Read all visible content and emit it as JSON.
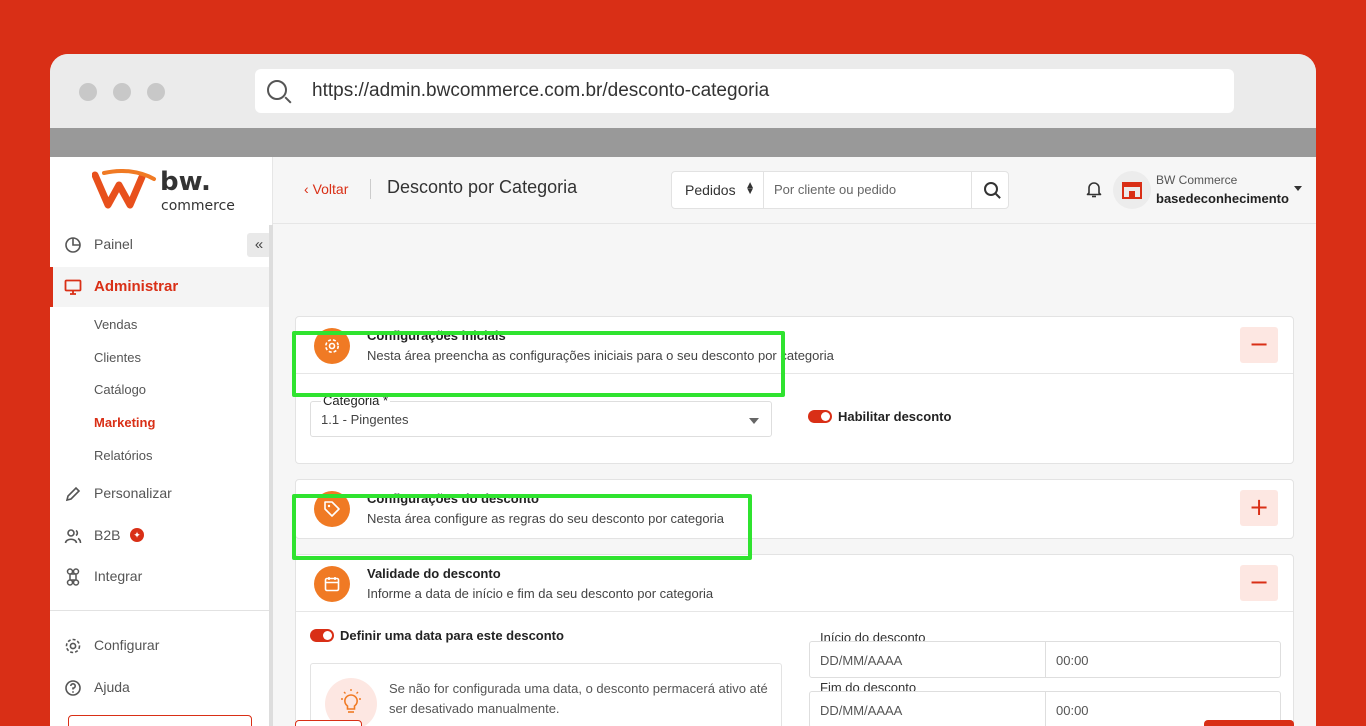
{
  "browser": {
    "url": "https://admin.bwcommerce.com.br/desconto-categoria"
  },
  "logo": {
    "brand": "bw.",
    "tagline": "commerce"
  },
  "sidebar": {
    "collapse_label": "«",
    "items": [
      {
        "label": "Painel",
        "icon": "pie-chart-icon"
      },
      {
        "label": "Administrar",
        "icon": "monitor-icon"
      },
      {
        "label": "Personalizar",
        "icon": "pencil-icon"
      },
      {
        "label": "B2B",
        "icon": "users-icon"
      },
      {
        "label": "Integrar",
        "icon": "command-icon"
      },
      {
        "label": "Configurar",
        "icon": "gear-icon"
      },
      {
        "label": "Ajuda",
        "icon": "help-icon"
      }
    ],
    "subitems": [
      {
        "label": "Vendas"
      },
      {
        "label": "Clientes"
      },
      {
        "label": "Catálogo"
      },
      {
        "label": "Marketing"
      },
      {
        "label": "Relatórios"
      }
    ]
  },
  "header": {
    "back_label": "Voltar",
    "title": "Desconto por Categoria",
    "search_scope": "Pedidos",
    "search_placeholder": "Por cliente ou pedido",
    "user_company": "BW Commerce",
    "user_name": "basedeconhecimento"
  },
  "sections": {
    "initial": {
      "title": "Configurações iniciais",
      "subtitle": "Nesta área preencha as configurações iniciais para o seu desconto por categoria",
      "toggle": "−",
      "category_label": "Categoria *",
      "category_value": "1.1 - Pingentes",
      "enable_label": "Habilitar desconto"
    },
    "discount": {
      "title": "Configurações do desconto",
      "subtitle": "Nesta área configure as regras do seu desconto por categoria",
      "toggle": "+"
    },
    "validity": {
      "title": "Validade do desconto",
      "subtitle": "Informe a data de início e fim da seu desconto por categoria",
      "toggle": "−",
      "define_date_label": "Definir uma data para este desconto",
      "info_text": "Se não for configurada uma data, o desconto permacerá ativo até ser desativado manualmente.",
      "start_label": "Início do desconto",
      "end_label": "Fim do desconto",
      "date_placeholder": "DD/MM/AAAA",
      "time_placeholder": "00:00"
    }
  },
  "colors": {
    "brand": "#d92f16",
    "accent_orange": "#f07a24",
    "highlight": "#2fe32f"
  }
}
